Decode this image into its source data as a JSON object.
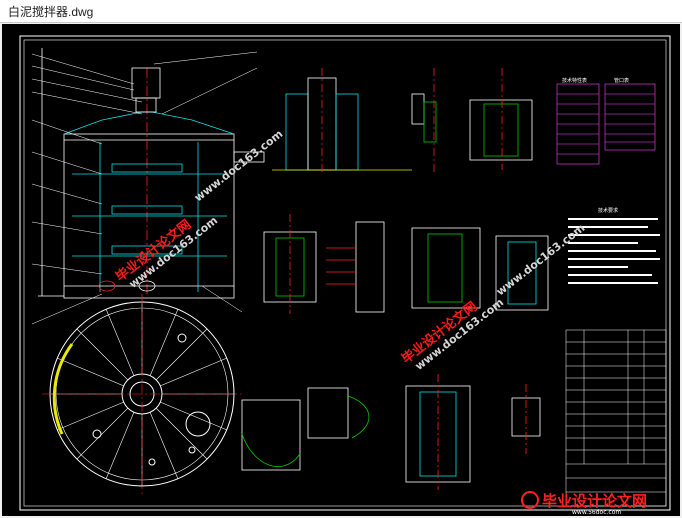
{
  "window": {
    "title": "白泥搅拌器.dwg"
  },
  "drawing": {
    "table_headers": {
      "left": "技术特性表",
      "right": "管口表",
      "notes": "技术要求"
    }
  },
  "watermarks": [
    {
      "text": "毕业设计论文网",
      "url": "www.doc163.com"
    },
    {
      "text": "毕业设计论文网",
      "url": "www.doc163.com"
    },
    {
      "text": "毕业设计论文网",
      "url": "www.doc163.com"
    },
    {
      "text": "毕业设计论文网",
      "url": "www.doc163.com"
    }
  ],
  "banner": {
    "text": "毕业设计论文网",
    "url": "www.56doc.com"
  },
  "colors": {
    "background": "#000000",
    "cyan": "#00e5e5",
    "white": "#ffffff",
    "red": "#ff2020",
    "green": "#00c800",
    "magenta": "#ff40ff",
    "yellow": "#e8e800"
  }
}
